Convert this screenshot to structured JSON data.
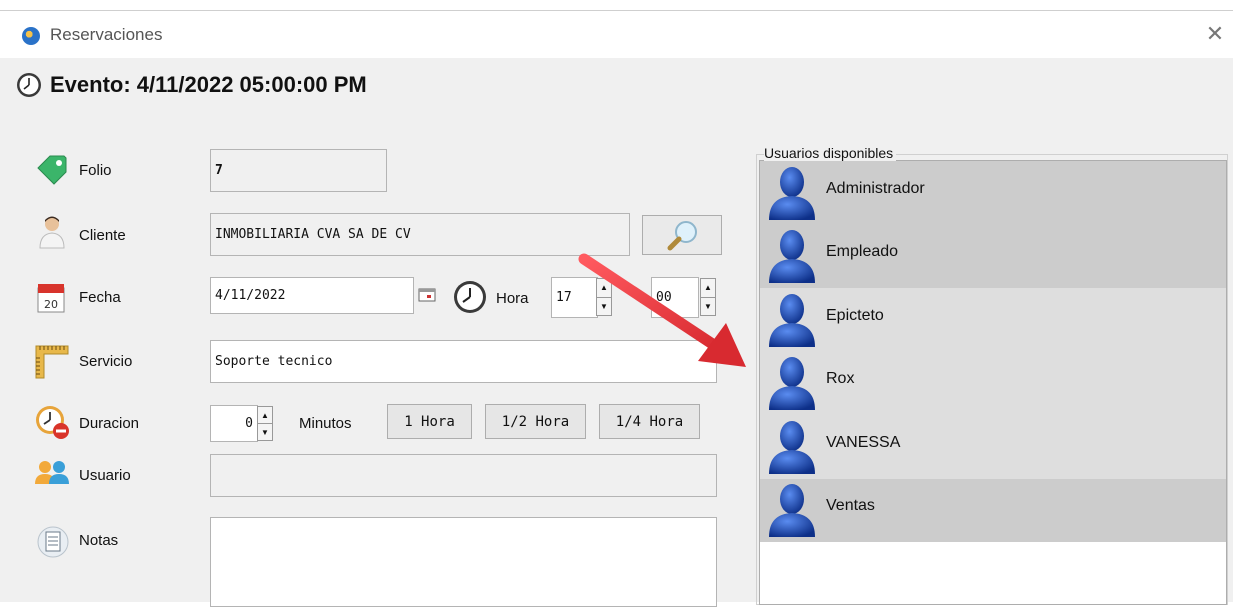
{
  "window": {
    "title": "Reservaciones",
    "close_glyph": "✕"
  },
  "event": {
    "title": "Evento: 4/11/2022 05:00:00 PM"
  },
  "form": {
    "folio": {
      "label": "Folio",
      "value": "7"
    },
    "cliente": {
      "label": "Cliente",
      "value": "INMOBILIARIA CVA SA DE CV"
    },
    "fecha": {
      "label": "Fecha",
      "value": "4/11/2022"
    },
    "hora": {
      "label": "Hora",
      "hour": "17",
      "separator": ":",
      "minute": "00"
    },
    "servicio": {
      "label": "Servicio",
      "value": "Soporte tecnico"
    },
    "duracion": {
      "label": "Duracion",
      "value": "0",
      "unit": "Minutos",
      "buttons": [
        "1 Hora",
        "1/2 Hora",
        "1/4 Hora"
      ]
    },
    "usuario": {
      "label": "Usuario",
      "value": ""
    },
    "notas": {
      "label": "Notas",
      "value": ""
    }
  },
  "users_panel": {
    "legend": "Usuarios disponibles",
    "users": [
      "Administrador",
      "Empleado",
      "Epicteto",
      "Rox",
      "VANESSA",
      "Ventas"
    ]
  },
  "colors": {
    "annotation_arrow": "#e8383d",
    "avatar_blue": "#1d4fb0"
  },
  "icons": [
    "app-icon",
    "clock-icon",
    "tag-icon",
    "person-icon",
    "calendar-icon",
    "ruler-icon",
    "timer-icon",
    "users-icon",
    "notepad-icon",
    "magnifier-icon",
    "user-avatar-icon"
  ]
}
